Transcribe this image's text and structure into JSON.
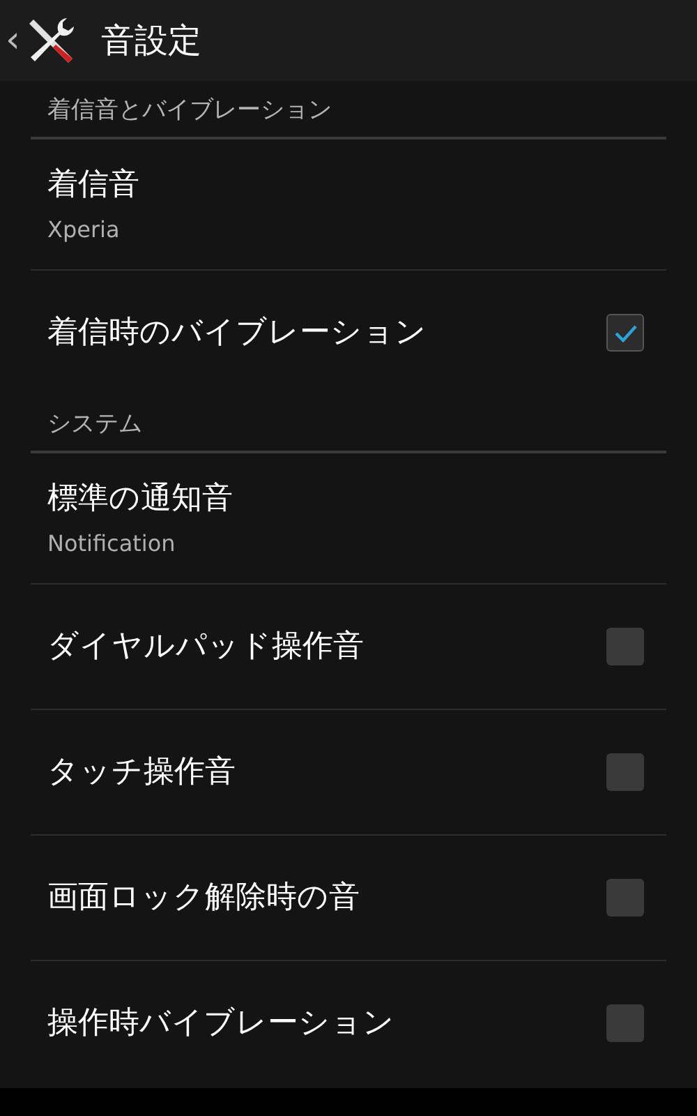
{
  "action_bar": {
    "back": "‹",
    "title": "音設定"
  },
  "items": [
    {
      "kind": "category",
      "title": "着信音とバイブレーション"
    },
    {
      "kind": "summary",
      "title": "着信音",
      "summary": "Xperia"
    },
    {
      "kind": "checkbox",
      "title": "着信時のバイブレーション",
      "checked": true
    },
    {
      "kind": "category",
      "title": "システム"
    },
    {
      "kind": "summary",
      "title": "標準の通知音",
      "summary": "Notification"
    },
    {
      "kind": "checkbox",
      "title": "ダイヤルパッド操作音",
      "checked": false
    },
    {
      "kind": "checkbox",
      "title": "タッチ操作音",
      "checked": false
    },
    {
      "kind": "checkbox",
      "title": "画面ロック解除時の音",
      "checked": false
    },
    {
      "kind": "checkbox",
      "title": "操作時バイブレーション",
      "checked": false
    }
  ]
}
